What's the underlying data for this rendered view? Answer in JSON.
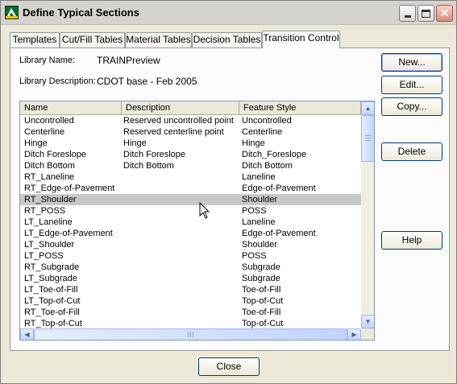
{
  "window": {
    "title": "Define Typical Sections",
    "controls": {
      "minimize": "minimize",
      "maximize": "maximize",
      "close": "close"
    }
  },
  "tabs": [
    {
      "label": "Templates",
      "active": false
    },
    {
      "label": "Cut/Fill Tables",
      "active": false
    },
    {
      "label": "Material Tables",
      "active": false
    },
    {
      "label": "Decision Tables",
      "active": false
    },
    {
      "label": "Transition Control",
      "active": true
    }
  ],
  "library": {
    "name_label": "Library Name:",
    "name_value": "TRAINPreview",
    "description_label": "Library Description:",
    "description_value": "CDOT base - Feb 2005"
  },
  "buttons": {
    "new": "New...",
    "edit": "Edit...",
    "copy": "Copy...",
    "delete": "Delete",
    "help": "Help",
    "close": "Close"
  },
  "table": {
    "columns": [
      "Name",
      "Description",
      "Feature Style"
    ],
    "selected_row_index": 7,
    "rows": [
      [
        "Uncontrolled",
        "Reserved uncontrolled point",
        "Uncontrolled"
      ],
      [
        "Centerline",
        "Reserved centerline point",
        "Centerline"
      ],
      [
        "Hinge",
        "Hinge",
        "Hinge"
      ],
      [
        "Ditch Foreslope",
        "Ditch Foreslope",
        "Ditch_Foreslope"
      ],
      [
        "Ditch Bottom",
        "Ditch Bottom",
        "Ditch Bottom"
      ],
      [
        "RT_Laneline",
        "",
        "Laneline"
      ],
      [
        "RT_Edge-of-Pavement",
        "",
        "Edge-of-Pavement"
      ],
      [
        "RT_Shoulder",
        "",
        "Shoulder"
      ],
      [
        "RT_POSS",
        "",
        "POSS"
      ],
      [
        "LT_Laneline",
        "",
        "Laneline"
      ],
      [
        "LT_Edge-of-Pavement",
        "",
        "Edge-of-Pavement"
      ],
      [
        "LT_Shoulder",
        "",
        "Shoulder"
      ],
      [
        "LT_POSS",
        "",
        "POSS"
      ],
      [
        "RT_Subgrade",
        "",
        "Subgrade"
      ],
      [
        "LT_Subgrade",
        "",
        "Subgrade"
      ],
      [
        "LT_Toe-of-Fill",
        "",
        "Toe-of-Fill"
      ],
      [
        "LT_Top-of-Cut",
        "",
        "Top-of-Cut"
      ],
      [
        "RT_Toe-of-Fill",
        "",
        "Toe-of-Fill"
      ],
      [
        "RT_Top-of-Cut",
        "",
        "Top-of-Cut"
      ]
    ]
  },
  "icons": {
    "app": "app-icon",
    "scroll_up": "scroll-up-arrow-icon",
    "scroll_down": "scroll-down-arrow-icon",
    "scroll_left": "scroll-left-arrow-icon",
    "scroll_right": "scroll-right-arrow-icon",
    "pointer": "mouse-pointer-icon"
  },
  "colors": {
    "window_bg": "#ece9d8",
    "selected_row": "#c8c8c8",
    "button_border": "#003c74"
  }
}
